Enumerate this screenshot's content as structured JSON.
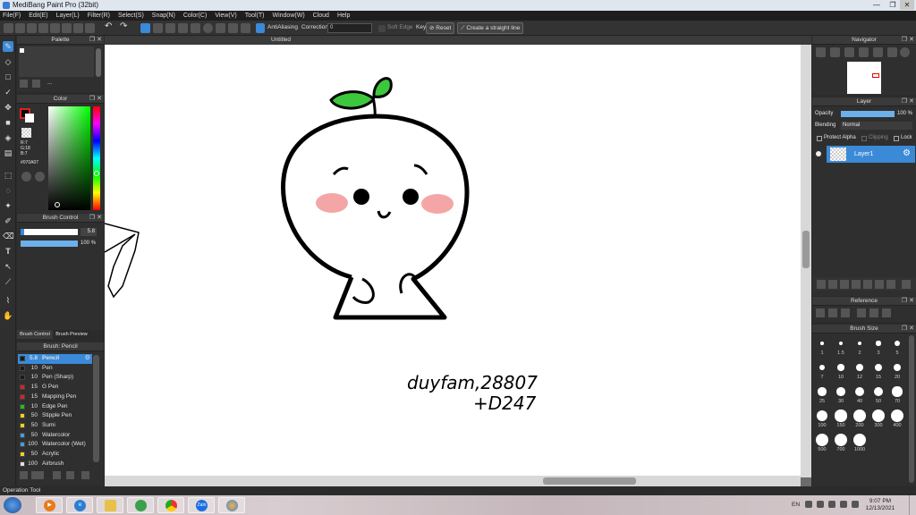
{
  "window": {
    "title": "MediBang Paint Pro (32bit)"
  },
  "menu": [
    "File(F)",
    "Edit(E)",
    "Layer(L)",
    "Filter(R)",
    "Select(S)",
    "Snap(N)",
    "Color(C)",
    "View(V)",
    "Tool(T)",
    "Window(W)",
    "Cloud",
    "Help"
  ],
  "toolbar": {
    "antialiasing": "AntiAliasing",
    "correction_label": "Correction",
    "correction_value": "0",
    "soft_edge": "Soft Edge",
    "key": "Key",
    "reset": "Reset",
    "straight_line": "Create a straight line"
  },
  "panels": {
    "palette": "Palette",
    "palette_menu": "...",
    "color": "Color",
    "color_values": {
      "r": "R:7",
      "g": "G:18",
      "b": "B:7",
      "hex": "#070A07"
    },
    "brush_control": "Brush Control",
    "brush_size_value": "5.8",
    "brush_opacity_value": "100 %",
    "tab_brush_control": "Brush Control",
    "tab_brush_preview": "Brush Preview",
    "brush_list_title": "Brush: Pencil",
    "navigator": "Navigator",
    "layer": "Layer",
    "opacity_label": "Opacity",
    "opacity_value": "100 %",
    "blending_label": "Blending",
    "blending_value": "Normal",
    "protect_alpha": "Protect Alpha",
    "clipping": "Clipping",
    "lock": "Lock",
    "layer_name": "Layer1",
    "reference": "Reference",
    "brush_size": "Brush Size"
  },
  "brushes": [
    {
      "size": "5.8",
      "name": "Pencil",
      "color": "#1a1a1a",
      "selected": true
    },
    {
      "size": "10",
      "name": "Pen",
      "color": "#1a1a1a"
    },
    {
      "size": "10",
      "name": "Pen (Sharp)",
      "color": "#1a1a1a"
    },
    {
      "size": "15",
      "name": "G Pen",
      "color": "#e02020"
    },
    {
      "size": "15",
      "name": "Mapping Pen",
      "color": "#e02020"
    },
    {
      "size": "10",
      "name": "Edge Pen",
      "color": "#20c020"
    },
    {
      "size": "50",
      "name": "Stipple Pen",
      "color": "#f0d020"
    },
    {
      "size": "50",
      "name": "Sumi",
      "color": "#f0d020"
    },
    {
      "size": "50",
      "name": "Watercolor",
      "color": "#40a0e0"
    },
    {
      "size": "100",
      "name": "Watercolor (Wet)",
      "color": "#40a0e0"
    },
    {
      "size": "50",
      "name": "Acrylic",
      "color": "#f0d020"
    },
    {
      "size": "100",
      "name": "Airbrush",
      "color": "#e0e0e0"
    }
  ],
  "brush_sizes": [
    "1",
    "1.5",
    "2",
    "3",
    "5",
    "7",
    "10",
    "12",
    "15",
    "20",
    "25",
    "30",
    "40",
    "50",
    "70",
    "100",
    "150",
    "200",
    "300",
    "400",
    "500",
    "700",
    "1000"
  ],
  "canvas": {
    "tab": "Untitled",
    "handwriting_line1": "duyfam,28807",
    "handwriting_line2": "+D247"
  },
  "status": {
    "text": "Operation Tool"
  },
  "taskbar": {
    "zalo": "Zalo",
    "lang": "EN",
    "time": "9:07 PM",
    "date": "12/13/2021"
  },
  "colors": {
    "accent": "#3a8ad8",
    "panel": "#2f2f2f",
    "sprout": "#3cc83c",
    "blush": "#f4a6a6"
  }
}
